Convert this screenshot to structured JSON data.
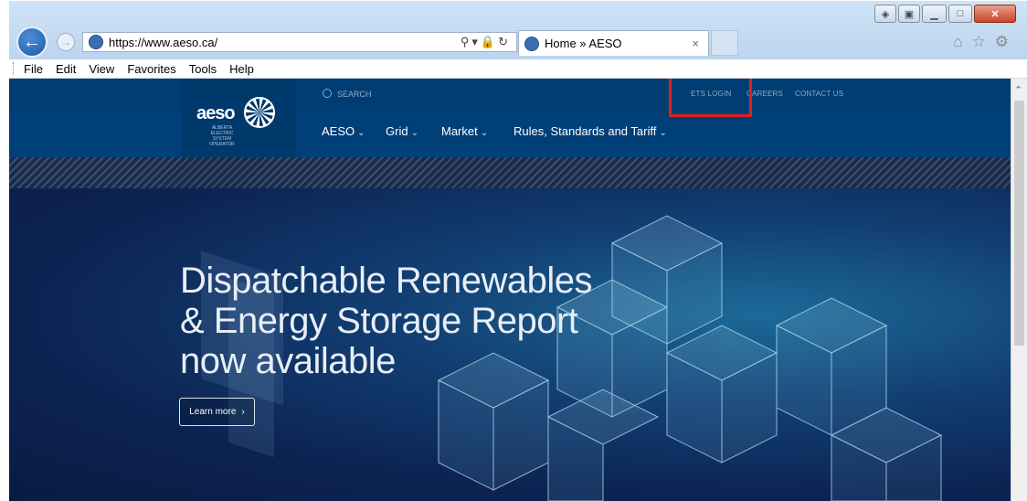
{
  "browser": {
    "url_scheme": "https://",
    "url_host": "www.aeso.ca/",
    "tab_title": "Home » AESO",
    "tab_close": "×",
    "menu": [
      "File",
      "Edit",
      "View",
      "Favorites",
      "Tools",
      "Help"
    ],
    "toolbar_icons": [
      "home-icon",
      "star-icon",
      "gear-icon"
    ],
    "window_controls": [
      "compat-icon",
      "pin-icon",
      "minimize-icon",
      "maximize-icon",
      "close-icon"
    ]
  },
  "site": {
    "logo": "aeso",
    "logo_sub": "ALBERTA ELECTRIC SYSTEM OPERATOR",
    "search_label": "SEARCH",
    "utility_links": [
      "ETS LOGIN",
      "CAREERS",
      "CONTACT US"
    ],
    "nav": [
      "AESO",
      "Grid",
      "Market",
      "Rules, Standards and Tariff"
    ],
    "hero_title": "Dispatchable Renewables\n& Energy Storage Report\nnow available",
    "cta_label": "Learn more",
    "highlight_color": "#e0201b",
    "brand_color": "#003f78"
  }
}
